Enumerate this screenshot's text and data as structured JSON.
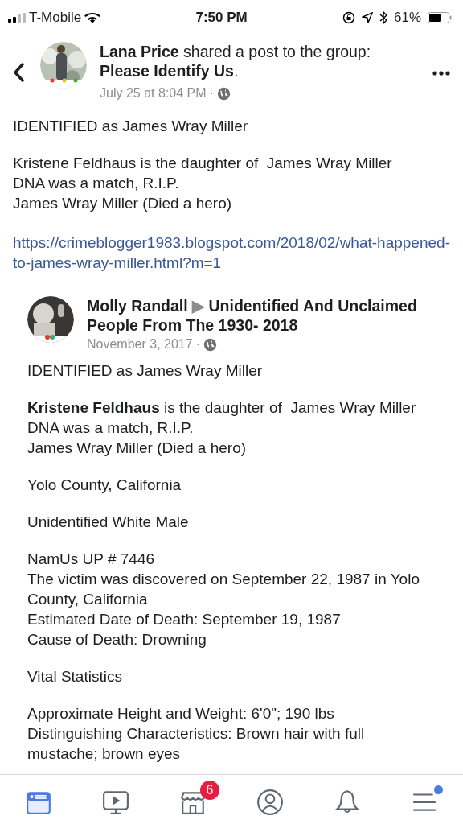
{
  "status_bar": {
    "carrier": "T-Mobile",
    "time": "7:50 PM",
    "battery": "61%"
  },
  "post": {
    "author": "Lana Price",
    "action": "shared a post to the group:",
    "group": "Please Identify Us",
    "after_group": ".",
    "time": "July 25 at 8:04 PM",
    "separator": "·",
    "paragraphs": [
      [
        "IDENTIFIED as James Wray Miller"
      ],
      [
        "Kristene Feldhaus is the daughter of  James Wray Miller",
        "DNA was a match, R.I.P.",
        "James Wray Miller (Died a hero)"
      ]
    ],
    "link": "https://crimeblogger1983.blogspot.com/2018/02/what-happened-to-james-wray-miller.html?m=1"
  },
  "shared_post": {
    "author": "Molly Randall",
    "arrow": "▶",
    "group": "Unidentified And Unclaimed People From The 1930- 2018",
    "time": "November 3, 2017",
    "separator": "·",
    "paragraphs": [
      [
        "IDENTIFIED as James Wray Miller"
      ],
      [
        "**Kristene Feldhaus** is the daughter of  James Wray Miller",
        "DNA was a match, R.I.P.",
        "James Wray Miller (Died a hero)"
      ],
      [
        "Yolo County, California"
      ],
      [
        "Unidentified White Male"
      ],
      [
        "NamUs UP # 7446",
        "The victim was discovered on September 22, 1987 in Yolo County, California",
        "Estimated Date of Death: September 19, 1987",
        "Cause of Death: Drowning"
      ],
      [
        "Vital Statistics"
      ],
      [
        "Approximate Height and Weight: 6'0\"; 190 lbs",
        "Distinguishing Characteristics: Brown hair with full mustache; brown eyes"
      ]
    ]
  },
  "tabs": [
    {
      "kind": "feed",
      "selected": true
    },
    {
      "kind": "video",
      "selected": false
    },
    {
      "kind": "market",
      "selected": false,
      "badge": "6"
    },
    {
      "kind": "profile",
      "selected": false
    },
    {
      "kind": "bell",
      "selected": false
    },
    {
      "kind": "menu",
      "selected": false,
      "dot": true
    }
  ]
}
